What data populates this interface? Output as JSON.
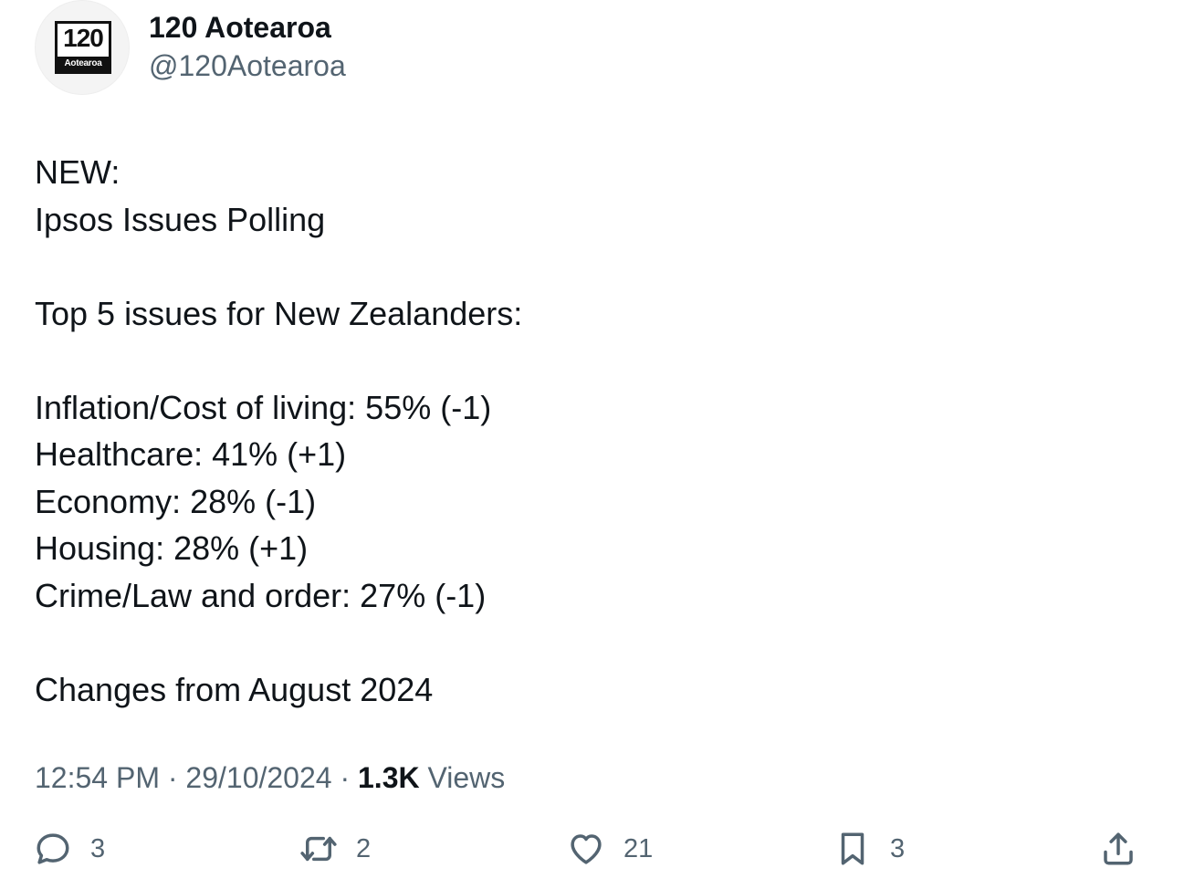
{
  "author": {
    "display_name": "120 Aotearoa",
    "handle": "@120Aotearoa",
    "avatar": {
      "number": "120",
      "wordmark": "Aotearoa"
    }
  },
  "post": {
    "lines": [
      "NEW:",
      "Ipsos Issues Polling",
      "",
      "Top 5 issues for New Zealanders:",
      "",
      "Inflation/Cost of living: 55% (-1)",
      "Healthcare: 41% (+1)",
      "Economy: 28% (-1)",
      "Housing: 28% (+1)",
      "Crime/Law and order: 27% (-1)",
      "",
      "Changes from August 2024"
    ]
  },
  "meta": {
    "time": "12:54 PM",
    "separator": " · ",
    "date": "29/10/2024",
    "views_count": "1.3K",
    "views_label": " Views"
  },
  "actions": {
    "reply": {
      "icon": "reply-icon",
      "count": "3"
    },
    "repost": {
      "icon": "repost-icon",
      "count": "2"
    },
    "like": {
      "icon": "heart-icon",
      "count": "21"
    },
    "bookmark": {
      "icon": "bookmark-icon",
      "count": "3"
    },
    "share": {
      "icon": "share-icon"
    }
  },
  "colors": {
    "text_primary": "#0f1419",
    "text_secondary": "#536471",
    "background": "#ffffff"
  }
}
